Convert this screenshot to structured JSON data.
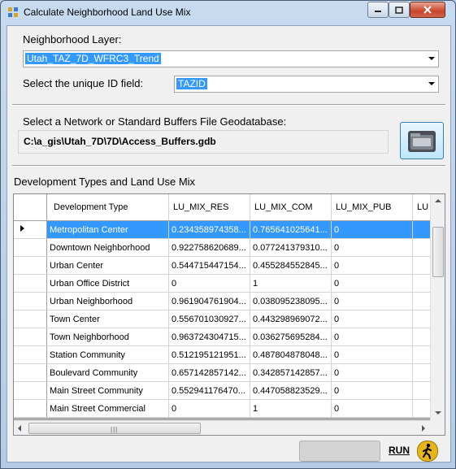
{
  "window": {
    "title": "Calculate Neighborhood Land Use Mix"
  },
  "layer": {
    "label": "Neighborhood Layer:",
    "value": "Utah_TAZ_7D_WFRC3_Trend"
  },
  "id_field": {
    "label": "Select the unique ID field:",
    "value": "TAZID"
  },
  "network": {
    "label": "Select a Network or Standard Buffers File Geodatabase:",
    "path": "C:\\a_gis\\Utah_7D\\7D\\Access_Buffers.gdb",
    "browse_icon": "folder-icon"
  },
  "grid": {
    "label": "Development Types and Land Use Mix",
    "columns": [
      "Development Type",
      "LU_MIX_RES",
      "LU_MIX_COM",
      "LU_MIX_PUB",
      "LU"
    ],
    "rows": [
      [
        "Metropolitan Center",
        "0.234358974358...",
        "0.765641025641...",
        "0"
      ],
      [
        "Downtown Neighborhood",
        "0.922758620689...",
        "0.077241379310...",
        "0"
      ],
      [
        "Urban Center",
        "0.544715447154...",
        "0.455284552845...",
        "0"
      ],
      [
        "Urban Office District",
        "0",
        "1",
        "0"
      ],
      [
        "Urban Neighborhood",
        "0.961904761904...",
        "0.038095238095...",
        "0"
      ],
      [
        "Town Center",
        "0.556701030927...",
        "0.443298969072...",
        "0"
      ],
      [
        "Town Neighborhood",
        "0.963724304715...",
        "0.036275695284...",
        "0"
      ],
      [
        "Station Community",
        "0.512195121951...",
        "0.487804878048...",
        "0"
      ],
      [
        "Boulevard Community",
        "0.657142857142...",
        "0.342857142857...",
        "0"
      ],
      [
        "Main Street Community",
        "0.552941176470...",
        "0.447058823529...",
        "0"
      ],
      [
        "Main Street Commercial",
        "0",
        "1",
        "0"
      ]
    ],
    "selected_row": 0
  },
  "run": {
    "label": "RUN",
    "icon": "running-man-icon"
  },
  "colors": {
    "selection": "#3399ff",
    "client_bg": "#f0f0f0"
  }
}
